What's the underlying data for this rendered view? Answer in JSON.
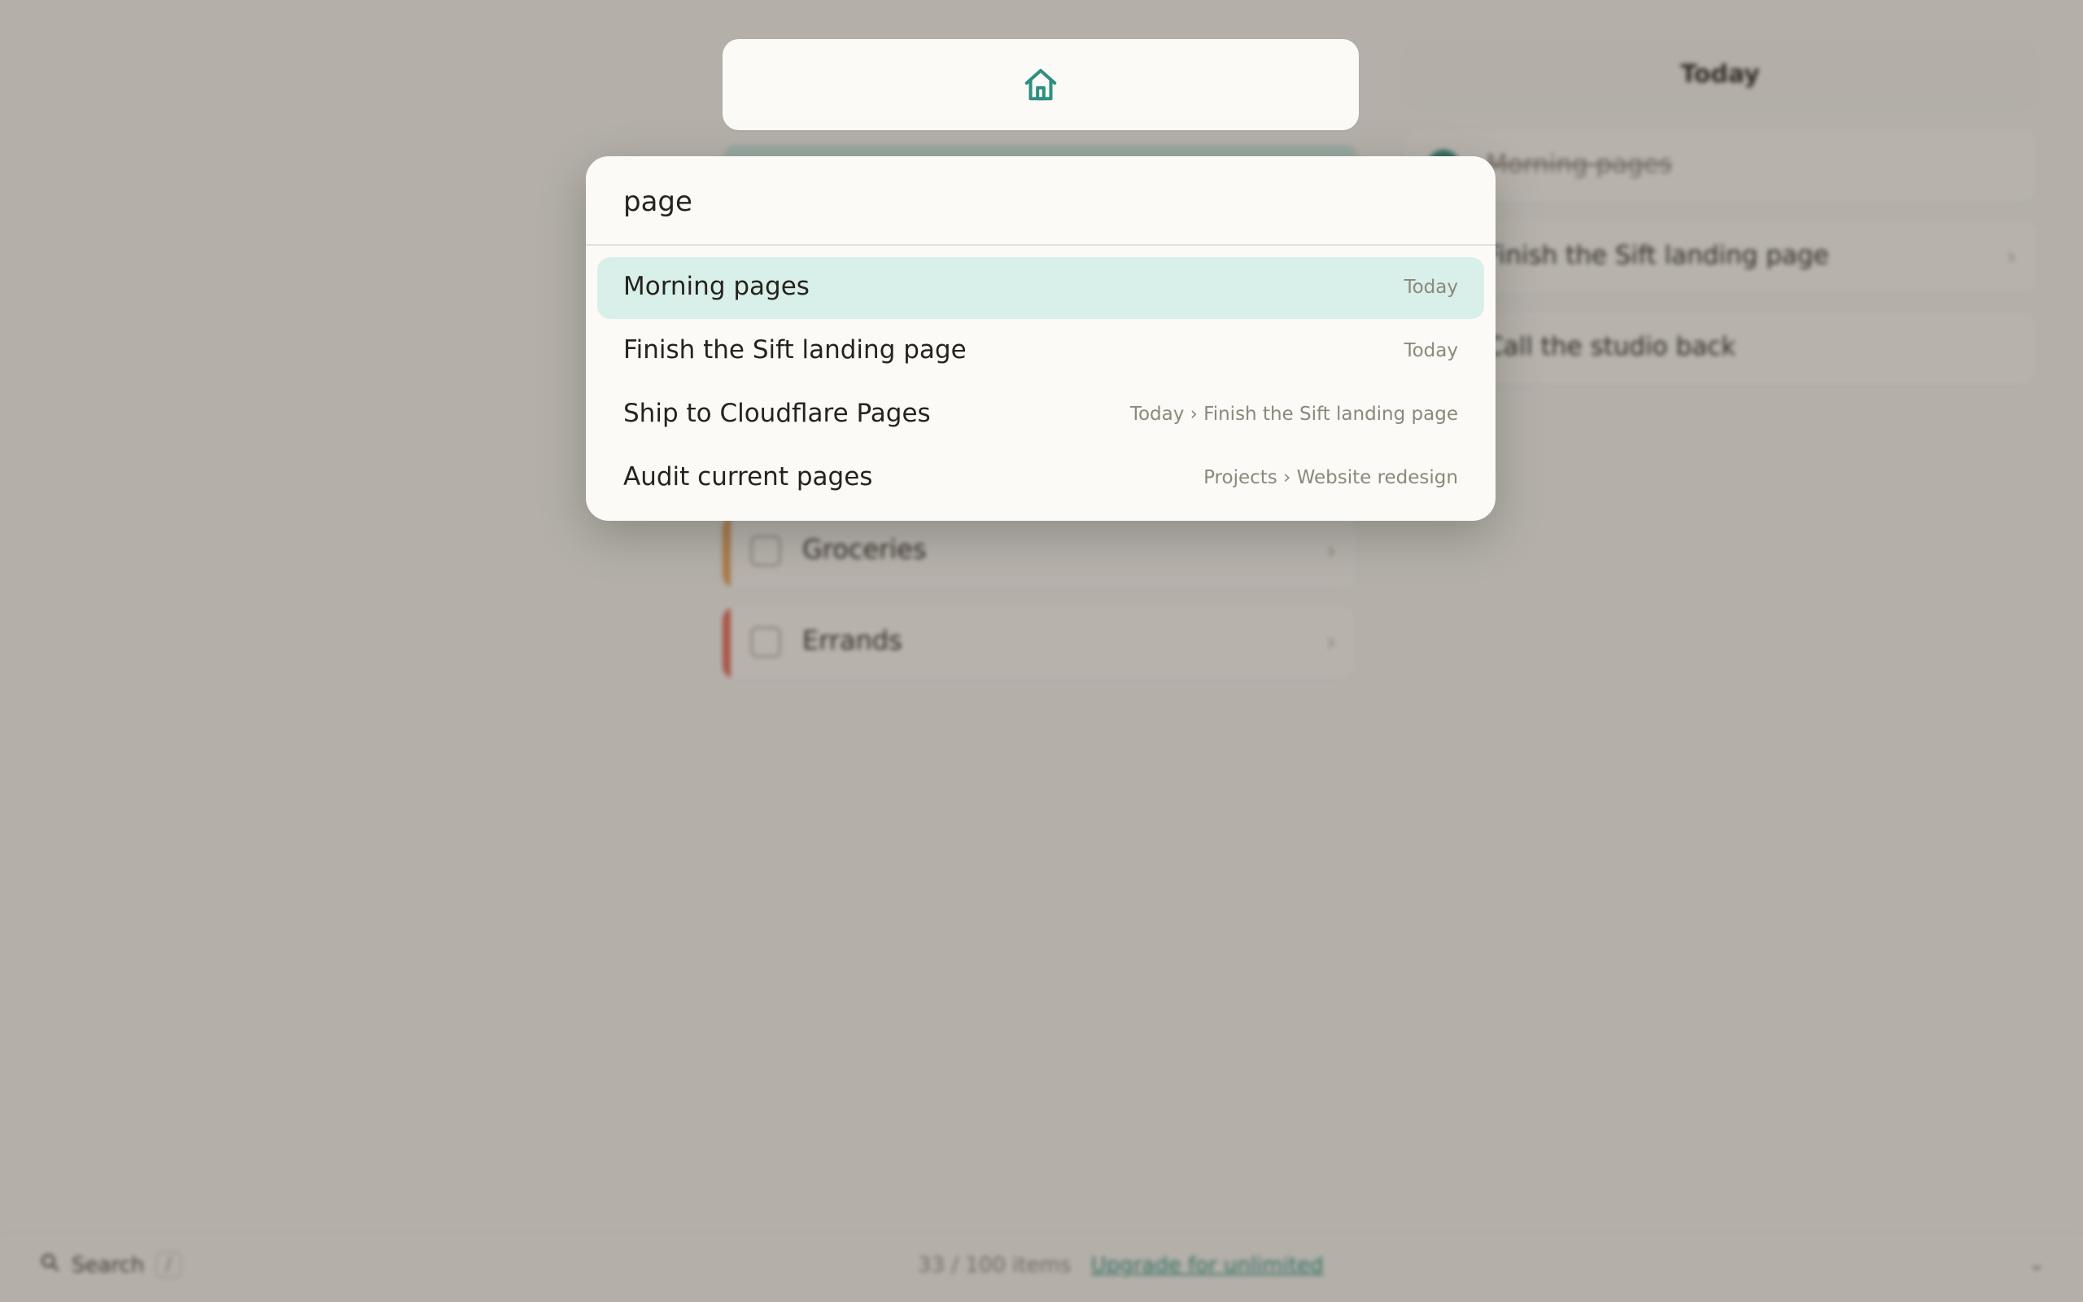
{
  "background": {
    "list_cards": [
      {
        "label": "Groceries",
        "stripe_color": "#e3a25c"
      },
      {
        "label": "Errands",
        "stripe_color": "#e06b5c"
      }
    ],
    "today": {
      "header": "Today",
      "items": [
        {
          "label": "Morning pages",
          "done": true
        },
        {
          "label": "Finish the Sift landing page",
          "done": false
        },
        {
          "label": "Call the studio back",
          "done": false
        }
      ]
    },
    "footer": {
      "search_label": "Search",
      "search_shortcut": "/",
      "items_count": "33 / 100 items",
      "upgrade_link": "Upgrade for unlimited"
    }
  },
  "home_bar": {
    "icon": "home-icon"
  },
  "palette": {
    "query": "page",
    "results": [
      {
        "title": "Morning pages",
        "path": "Today",
        "selected": true
      },
      {
        "title": "Finish the Sift landing page",
        "path": "Today",
        "selected": false
      },
      {
        "title": "Ship to Cloudflare Pages",
        "path": "Today › Finish the Sift landing page",
        "selected": false
      },
      {
        "title": "Audit current pages",
        "path": "Projects › Website redesign",
        "selected": false
      }
    ]
  },
  "colors": {
    "accent": "#2f8f80",
    "selection": "#d9efe9"
  }
}
